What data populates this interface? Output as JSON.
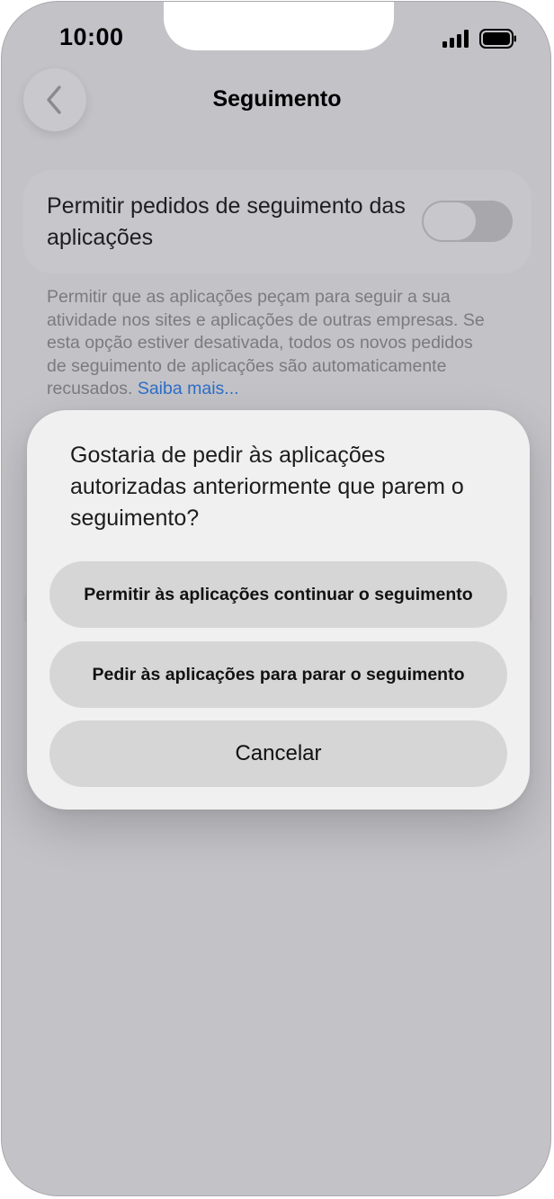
{
  "status_bar": {
    "time": "10:00",
    "signal_icon": "cellular-signal-icon",
    "battery_icon": "battery-icon"
  },
  "nav": {
    "back_icon": "chevron-left-icon",
    "title": "Seguimento"
  },
  "settings": {
    "toggle_label": "Permitir pedidos de seguimento das aplicações",
    "toggle_state": "off",
    "footer_text": "Permitir que as aplicações peçam para seguir a sua atividade nos sites e aplicações de outras empresas. Se esta opção estiver desativada, todos os novos pedidos de seguimento de aplicações são automaticamente recusados.",
    "footer_link": "Saiba mais..."
  },
  "dialog": {
    "title": "Gostaria de pedir às aplicações autorizadas anteriormente que parem o seguimento?",
    "buttons": [
      {
        "label": "Permitir às aplicações continuar o seguimento"
      },
      {
        "label": "Pedir às aplicações para parar o seguimento"
      },
      {
        "label": "Cancelar"
      }
    ]
  },
  "colors": {
    "background_dim": "#c3c2c7",
    "dialog_bg": "#f0f0f0",
    "button_bg": "#d6d6d6",
    "link": "#2d6ec7"
  }
}
